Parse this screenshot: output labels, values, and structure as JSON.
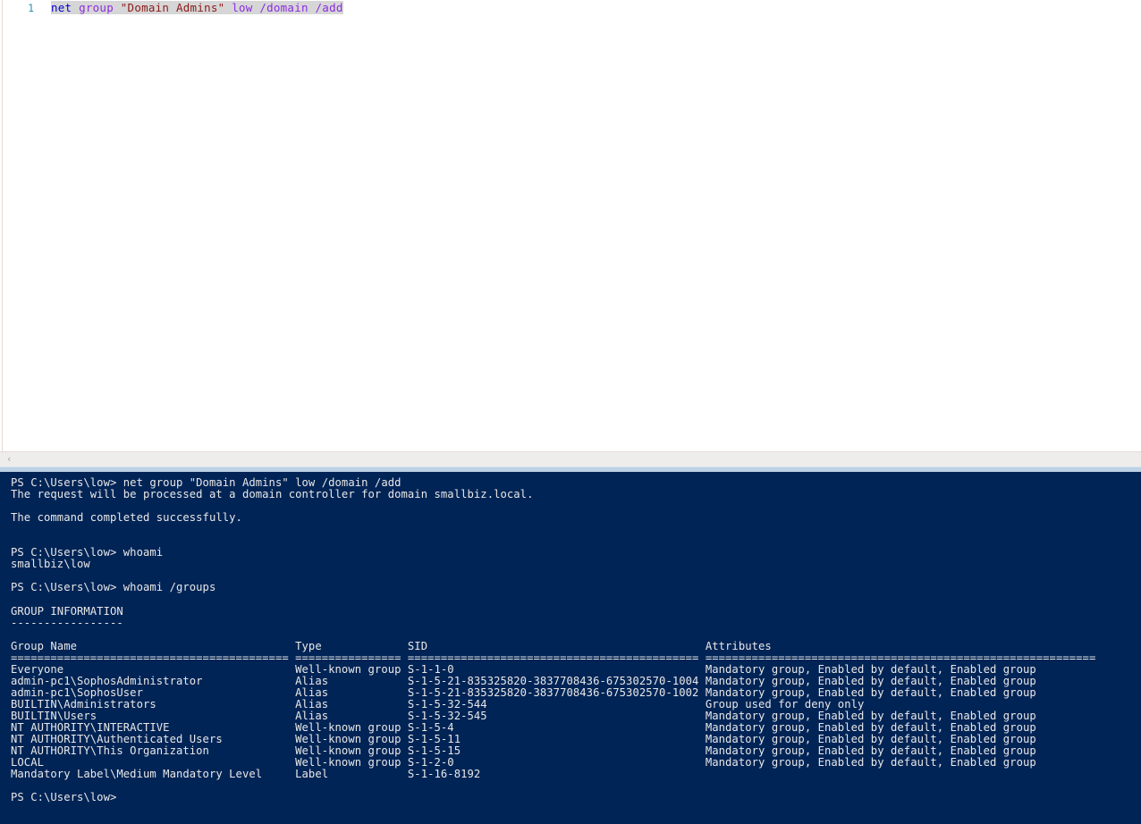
{
  "editor": {
    "line_number": "1",
    "code": {
      "full_text": "net group \"Domain Admins\" low /domain /add",
      "tokens": [
        {
          "text": "net",
          "type": "command"
        },
        {
          "text": " ",
          "type": "plain"
        },
        {
          "text": "group",
          "type": "parameter"
        },
        {
          "text": " ",
          "type": "plain"
        },
        {
          "text": "\"Domain Admins\"",
          "type": "string"
        },
        {
          "text": " ",
          "type": "plain"
        },
        {
          "text": "low",
          "type": "switch"
        },
        {
          "text": " ",
          "type": "plain"
        },
        {
          "text": "/domain",
          "type": "switch"
        },
        {
          "text": " ",
          "type": "plain"
        },
        {
          "text": "/add",
          "type": "switch"
        }
      ]
    },
    "selection_highlight_color": "#d6d6d6",
    "background_color": "#ffffff",
    "gutter_color": "#2b91af"
  },
  "scrollbar": {
    "left_arrow_glyph": "‹",
    "track_color": "#eeedec"
  },
  "splitter": {
    "color": "#bcd2e4"
  },
  "terminal": {
    "background_color": "#012456",
    "foreground_color": "#e8e8e8",
    "prompt": "PS C:\\Users\\low>",
    "lines": [
      "PS C:\\Users\\low> net group \"Domain Admins\" low /domain /add",
      "The request will be processed at a domain controller for domain smallbiz.local.",
      "",
      "The command completed successfully.",
      "",
      "",
      "PS C:\\Users\\low> whoami",
      "smallbiz\\low",
      "",
      "PS C:\\Users\\low> whoami /groups",
      "",
      "GROUP INFORMATION",
      "-----------------",
      "",
      "Group Name                                 Type             SID                                          Attributes                                                 ",
      "========================================== ================ ============================================ ===========================================================",
      "Everyone                                   Well-known group S-1-1-0                                      Mandatory group, Enabled by default, Enabled group         ",
      "admin-pc1\\SophosAdministrator              Alias            S-1-5-21-835325820-3837708436-675302570-1004 Mandatory group, Enabled by default, Enabled group         ",
      "admin-pc1\\SophosUser                       Alias            S-1-5-21-835325820-3837708436-675302570-1002 Mandatory group, Enabled by default, Enabled group         ",
      "BUILTIN\\Administrators                     Alias            S-1-5-32-544                                 Group used for deny only                                   ",
      "BUILTIN\\Users                              Alias            S-1-5-32-545                                 Mandatory group, Enabled by default, Enabled group         ",
      "NT AUTHORITY\\INTERACTIVE                   Well-known group S-1-5-4                                      Mandatory group, Enabled by default, Enabled group         ",
      "NT AUTHORITY\\Authenticated Users           Well-known group S-1-5-11                                     Mandatory group, Enabled by default, Enabled group         ",
      "NT AUTHORITY\\This Organization             Well-known group S-1-5-15                                     Mandatory group, Enabled by default, Enabled group         ",
      "LOCAL                                      Well-known group S-1-2-0                                      Mandatory group, Enabled by default, Enabled group         ",
      "Mandatory Label\\Medium Mandatory Level     Label            S-1-16-8192                                                                                             ",
      "",
      "PS C:\\Users\\low>"
    ],
    "group_information": {
      "heading": "GROUP INFORMATION",
      "underline": "-----------------",
      "columns": [
        "Group Name",
        "Type",
        "SID",
        "Attributes"
      ],
      "rows": [
        {
          "group_name": "Everyone",
          "type": "Well-known group",
          "sid": "S-1-1-0",
          "attributes": "Mandatory group, Enabled by default, Enabled group"
        },
        {
          "group_name": "admin-pc1\\SophosAdministrator",
          "type": "Alias",
          "sid": "S-1-5-21-835325820-3837708436-675302570-1004",
          "attributes": "Mandatory group, Enabled by default, Enabled group"
        },
        {
          "group_name": "admin-pc1\\SophosUser",
          "type": "Alias",
          "sid": "S-1-5-21-835325820-3837708436-675302570-1002",
          "attributes": "Mandatory group, Enabled by default, Enabled group"
        },
        {
          "group_name": "BUILTIN\\Administrators",
          "type": "Alias",
          "sid": "S-1-5-32-544",
          "attributes": "Group used for deny only"
        },
        {
          "group_name": "BUILTIN\\Users",
          "type": "Alias",
          "sid": "S-1-5-32-545",
          "attributes": "Mandatory group, Enabled by default, Enabled group"
        },
        {
          "group_name": "NT AUTHORITY\\INTERACTIVE",
          "type": "Well-known group",
          "sid": "S-1-5-4",
          "attributes": "Mandatory group, Enabled by default, Enabled group"
        },
        {
          "group_name": "NT AUTHORITY\\Authenticated Users",
          "type": "Well-known group",
          "sid": "S-1-5-11",
          "attributes": "Mandatory group, Enabled by default, Enabled group"
        },
        {
          "group_name": "NT AUTHORITY\\This Organization",
          "type": "Well-known group",
          "sid": "S-1-5-15",
          "attributes": "Mandatory group, Enabled by default, Enabled group"
        },
        {
          "group_name": "LOCAL",
          "type": "Well-known group",
          "sid": "S-1-2-0",
          "attributes": "Mandatory group, Enabled by default, Enabled group"
        },
        {
          "group_name": "Mandatory Label\\Medium Mandatory Level",
          "type": "Label",
          "sid": "S-1-16-8192",
          "attributes": ""
        }
      ]
    },
    "command_results": {
      "net_group_command": "net group \"Domain Admins\" low /domain /add",
      "net_group_notice": "The request will be processed at a domain controller for domain smallbiz.local.",
      "net_group_success": "The command completed successfully.",
      "whoami_command": "whoami",
      "whoami_result": "smallbiz\\low",
      "whoami_groups_command": "whoami /groups"
    }
  }
}
